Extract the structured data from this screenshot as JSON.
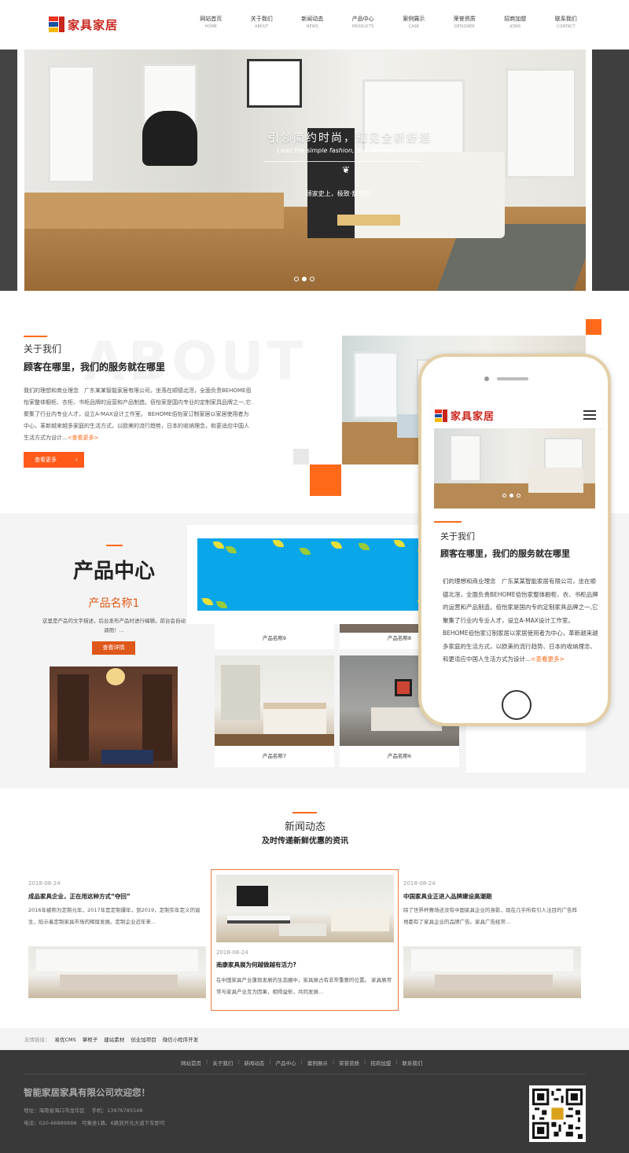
{
  "header": {
    "logo_text": "家具家居",
    "nav": [
      {
        "cn": "网站首页",
        "en": "HOME"
      },
      {
        "cn": "关于我们",
        "en": "ABOUT"
      },
      {
        "cn": "新闻动态",
        "en": "NEWS"
      },
      {
        "cn": "产品中心",
        "en": "PRODUCTS"
      },
      {
        "cn": "案例展示",
        "en": "CASE"
      },
      {
        "cn": "荣誉资质",
        "en": "DESIGNER"
      },
      {
        "cn": "招商加盟",
        "en": "JOINS"
      },
      {
        "cn": "联系我们",
        "en": "CONTACT"
      }
    ]
  },
  "hero": {
    "title": "引领简约时尚，耀见全新舒适",
    "subtitle": "Lead the simple fashion, and see new comfort",
    "tagline": "顾家史上，极致·舒软款",
    "slide_count": 3,
    "active_slide": 1
  },
  "about": {
    "watermark": "ABOUT",
    "label": "关于我们",
    "title": "顾客在哪里，我们的服务就在哪里",
    "text": "我们的理想和商业理念　广东某某智能家居有限公司，坐落在顺德北滘，全面负责BEHOME佰怡家整体橱柜、衣柜、书柜品牌的运营和产品制造。佰怡家是国内专业的定制家具品牌之一,它聚集了行业内专业人才，设立A-MAX设计工作室。 BEHOME佰怡家订制家居以家居使用者为中心，革新越来越多家庭的生活方式，以欧美的流行趋势，日本的收纳理念，和更适应中国人生活方式为设计...",
    "more_link": "<查看更多>",
    "more_button": "查看更多",
    "arrow": "›"
  },
  "products": {
    "title": "产品中心",
    "featured_name": "产品名称1",
    "featured_desc": "这里是产品的文字描述，后台发布产品时进行编辑，前台会自动调用！...",
    "detail_button": "查看详情",
    "cards": [
      {
        "name": "产品名称9"
      },
      {
        "name": "产品名称8"
      },
      {
        "name": "产品名称7"
      },
      {
        "name": "产品名称6"
      }
    ]
  },
  "phone": {
    "logo_text": "家具家居",
    "about_label": "关于我们",
    "about_title": "顾客在哪里，我们的服务就在哪里",
    "about_text": "们的理想和商业理念　广东某某智能家居有限公司，坐在顺德北滘，全面负责BEHOME佰怡家整体橱柜、衣、书柜品牌的运营和产品制造。佰怡家是国内专的定制家具品牌之一,它聚集了行业内专业人才，设立A-MAX设计工作室。　BEHOME佰怡家订制家居以家居使用者为中心，革新越来越多家庭的生活方式，以欧美的流行趋势、日本的收纳理念、和更适应中国人生活方式为设计...",
    "more_link": "<查看更多>"
  },
  "news": {
    "title": "新闻动态",
    "subtitle": "及时传递新鲜优惠的资讯",
    "items": [
      {
        "date": "2018-08-24",
        "title": "成品家具企业，正在用这种方式“夺回”",
        "text": "2016年被称为定制元年，2017年是定制爆年，到2019，定制实年定义的诞生，陷示着定制家具市场的辉煌发展。定制企业近年来..."
      },
      {
        "date": "2018-08-24",
        "title": "南康家具展为何越做越有活力?",
        "text": "在中国家具产业蓬勃发展的生态圈中，家具展占有非常重要的位置。 家具展常常与家具产业互为因果，相得益彰，共同发展..."
      },
      {
        "date": "2018-08-24",
        "title": "中国家具业正进入品牌建设高潮期",
        "text": "除了世界杯赛场还没有中国家具企业的身影，现在几乎所有引人注目的广告阵地都有了家具企业的品牌广告。家具广告经常..."
      }
    ]
  },
  "links": {
    "label": "友情链接：",
    "items": [
      "易优CMS",
      "掌柜子",
      "建站素材",
      "创业加项目",
      "微信小程序开发"
    ]
  },
  "footer": {
    "nav": [
      "网站首页",
      "关于我们",
      "新闻动态",
      "产品中心",
      "案例展示",
      "荣誉资质",
      "招商加盟",
      "联系我们"
    ],
    "company": "智能家居家具有限公司欢迎您！",
    "address": "地址：海南省海口市龙华区　 手机：13976785548",
    "phone": "电话：020-66889888　可乘坐1路、6路到开元大道下车即可"
  },
  "colors": {
    "accent": "#ff6a1a",
    "brand_red": "#c8241b",
    "footer_bg": "#393939",
    "section_bg": "#f4f4f4"
  }
}
